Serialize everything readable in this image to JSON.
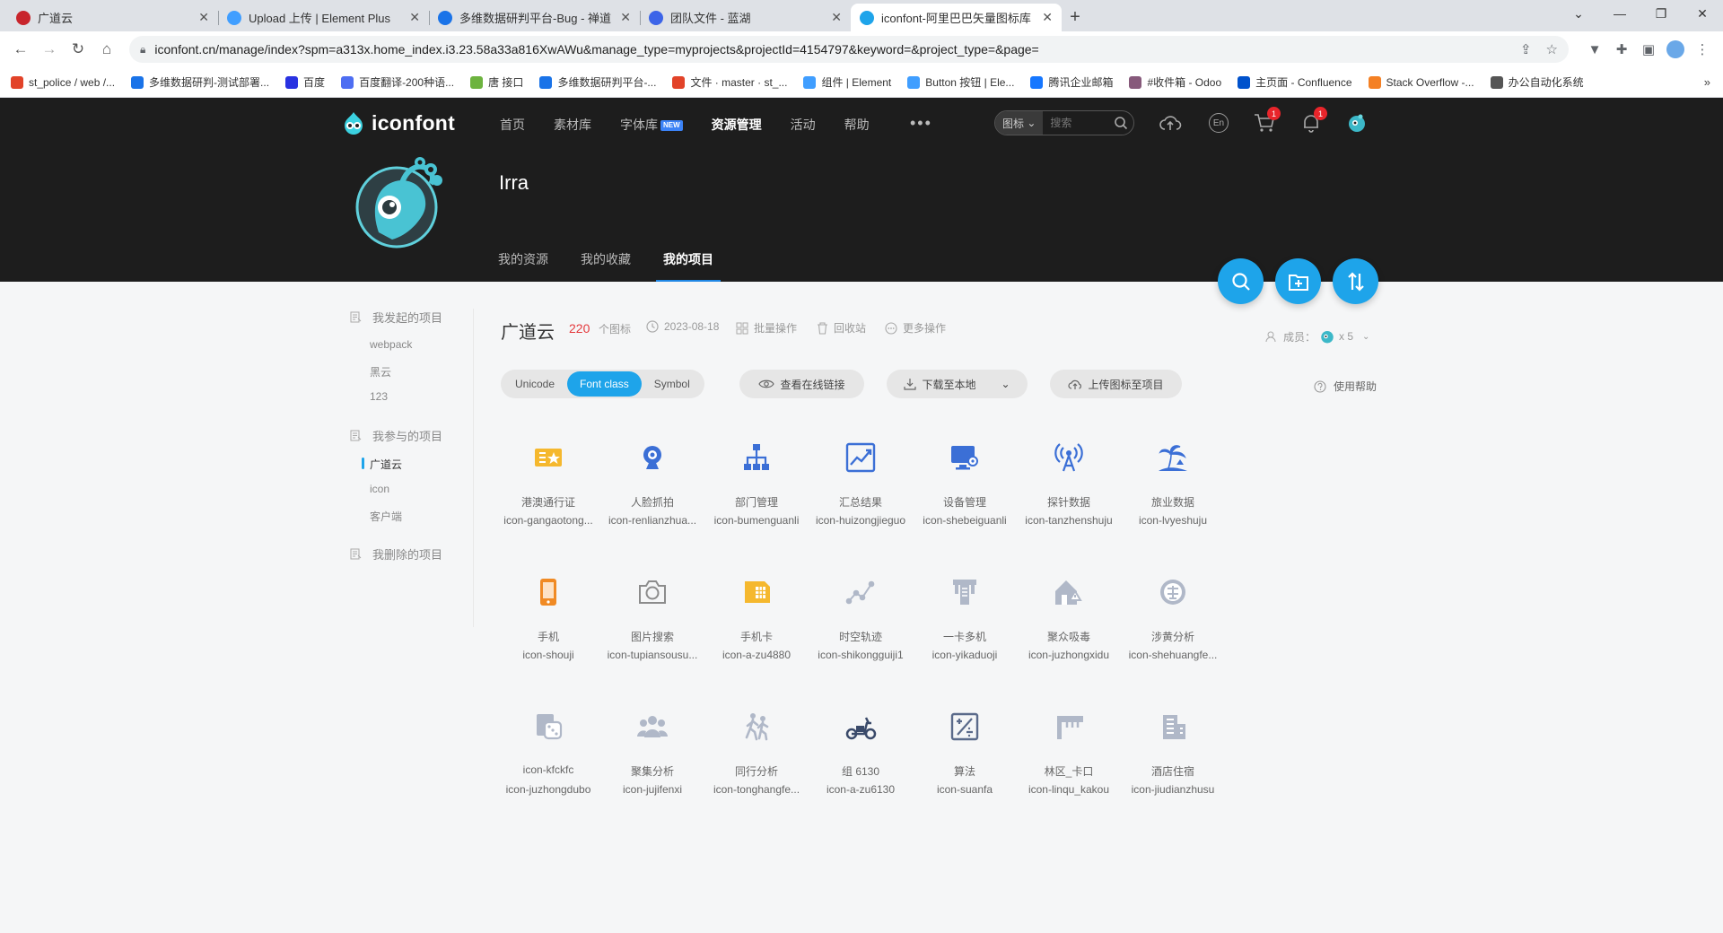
{
  "browser": {
    "tabs": [
      {
        "title": "广道云",
        "color": "#c8252c"
      },
      {
        "title": "Upload 上传 | Element Plus",
        "color": "#409eff"
      },
      {
        "title": "多维数据研判平台-Bug - 禅道",
        "color": "#1a73e8"
      },
      {
        "title": "团队文件 - 蓝湖",
        "color": "#3c64e8"
      },
      {
        "title": "iconfont-阿里巴巴矢量图标库",
        "color": "#1ea4ea"
      }
    ],
    "close_glyph": "✕",
    "new_tab_glyph": "+",
    "url": "iconfont.cn/manage/index?spm=a313x.home_index.i3.23.58a33a816XwAWu&manage_type=myprojects&projectId=4154797&keyword=&project_type=&page=",
    "bookmarks": [
      {
        "label": "st_police / web /...",
        "color": "#e24329"
      },
      {
        "label": "多维数据研判-测试部署...",
        "color": "#1a73e8"
      },
      {
        "label": "百度",
        "color": "#2932e1"
      },
      {
        "label": "百度翻译-200种语...",
        "color": "#4e6ef2"
      },
      {
        "label": "唐 接口",
        "color": "#6db33f"
      },
      {
        "label": "多维数据研判平台-...",
        "color": "#1a73e8"
      },
      {
        "label": "文件 · master · st_...",
        "color": "#e24329"
      },
      {
        "label": "组件 | Element",
        "color": "#409eff"
      },
      {
        "label": "Button 按钮 | Ele...",
        "color": "#409eff"
      },
      {
        "label": "腾讯企业邮箱",
        "color": "#1677ff"
      },
      {
        "label": "#收件箱 - Odoo",
        "color": "#875a7b"
      },
      {
        "label": "主页面 - Confluence",
        "color": "#0052cc"
      },
      {
        "label": "Stack Overflow -...",
        "color": "#f48024"
      },
      {
        "label": "办公自动化系统",
        "color": "#555555"
      }
    ],
    "bookmarks_more": "»"
  },
  "header": {
    "logo_text": "iconfont",
    "nav": [
      {
        "label": "首页",
        "active": false
      },
      {
        "label": "素材库",
        "active": false
      },
      {
        "label": "字体库",
        "active": false,
        "badge": "NEW"
      },
      {
        "label": "资源管理",
        "active": true
      },
      {
        "label": "活动",
        "active": false
      },
      {
        "label": "帮助",
        "active": false
      }
    ],
    "more": "•••",
    "search_type": "图标",
    "search_placeholder": "搜索",
    "lang": "En",
    "cart_badge": "1",
    "notify_badge": "1"
  },
  "profile": {
    "username": "Irra",
    "tabs": [
      "我的资源",
      "我的收藏",
      "我的项目"
    ],
    "active_tab": 2
  },
  "sidebar": {
    "groups": [
      {
        "title": "我发起的项目",
        "items": [
          "webpack",
          "黑云",
          "123"
        ]
      },
      {
        "title": "我参与的项目",
        "items": [
          "广道云",
          "icon",
          "客户端"
        ],
        "active_item": 0
      },
      {
        "title": "我删除的项目",
        "items": []
      }
    ]
  },
  "project": {
    "title": "广道云",
    "count": "220",
    "count_unit": "个图标",
    "date": "2023-08-18",
    "batch": "批量操作",
    "trash": "回收站",
    "more": "更多操作",
    "members_label": "成员：",
    "members_count": "x 5"
  },
  "toolbar": {
    "segments": [
      "Unicode",
      "Font class",
      "Symbol"
    ],
    "active_segment": 1,
    "view_link": "查看在线链接",
    "download": "下载至本地",
    "upload": "上传图标至项目",
    "help": "使用帮助"
  },
  "icons": [
    {
      "name": "港澳通行证",
      "code": "icon-gangaotong...",
      "glyph": "pass",
      "color": "#f5b82e"
    },
    {
      "name": "人脸抓拍",
      "code": "icon-renlianzhua...",
      "glyph": "webcam",
      "color": "#3b6fd6"
    },
    {
      "name": "部门管理",
      "code": "icon-bumenguanli",
      "glyph": "org",
      "color": "#3b6fd6"
    },
    {
      "name": "汇总结果",
      "code": "icon-huizongjieguo",
      "glyph": "trend",
      "color": "#3b6fd6"
    },
    {
      "name": "设备管理",
      "code": "icon-shebeiguanli",
      "glyph": "monitor",
      "color": "#3b6fd6"
    },
    {
      "name": "探针数据",
      "code": "icon-tanzhenshuju",
      "glyph": "antenna",
      "color": "#3b6fd6"
    },
    {
      "name": "旅业数据",
      "code": "icon-lvyeshuju",
      "glyph": "palm",
      "color": "#3b6fd6"
    },
    {
      "name": "手机",
      "code": "icon-shouji",
      "glyph": "phone",
      "color": "#f08a24"
    },
    {
      "name": "图片搜索",
      "code": "icon-tupiansousu...",
      "glyph": "camera",
      "color": "#8c8c8c"
    },
    {
      "name": "手机卡",
      "code": "icon-a-zu4880",
      "glyph": "simcard",
      "color": "#f5b82e"
    },
    {
      "name": "时空轨迹",
      "code": "icon-shikongguiji1",
      "glyph": "track",
      "color": "#b0b8c8"
    },
    {
      "name": "一卡多机",
      "code": "icon-yikaduoji",
      "glyph": "tcard",
      "color": "#b0b8c8"
    },
    {
      "name": "聚众吸毒",
      "code": "icon-juzhongxidu",
      "glyph": "house",
      "color": "#b0b8c8"
    },
    {
      "name": "涉黄分析",
      "code": "icon-shehuangfe...",
      "glyph": "seal",
      "color": "#b0b8c8"
    },
    {
      "name": "icon-kfckfc",
      "code": "icon-juzhongdubo",
      "glyph": "dice",
      "color": "#b0b8c8"
    },
    {
      "name": "聚集分析",
      "code": "icon-jujifenxi",
      "glyph": "group",
      "color": "#b0b8c8"
    },
    {
      "name": "同行分析",
      "code": "icon-tonghangfe...",
      "glyph": "walk",
      "color": "#b0b8c8"
    },
    {
      "name": "组 6130",
      "code": "icon-a-zu6130",
      "glyph": "scooter",
      "color": "#3a4a6a"
    },
    {
      "name": "算法",
      "code": "icon-suanfa",
      "glyph": "formula",
      "color": "#5a6a8a"
    },
    {
      "name": "林区_卡口",
      "code": "icon-linqu_kakou",
      "glyph": "gate",
      "color": "#b0b8c8"
    },
    {
      "name": "酒店住宿",
      "code": "icon-jiudianzhusu",
      "glyph": "hotel",
      "color": "#b0b8c8"
    }
  ]
}
